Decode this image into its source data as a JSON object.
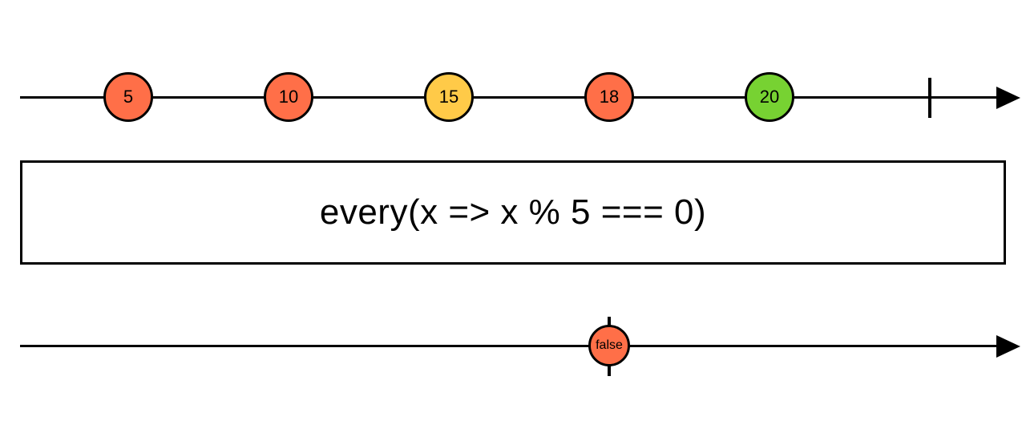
{
  "diagram": {
    "operator_label": "every(x => x % 5 === 0)",
    "input_marbles": [
      {
        "value": "5",
        "color": "#ff6f48"
      },
      {
        "value": "10",
        "color": "#ff6f48"
      },
      {
        "value": "15",
        "color": "#ffca48"
      },
      {
        "value": "18",
        "color": "#ff6f48"
      },
      {
        "value": "20",
        "color": "#77d232"
      }
    ],
    "output_marble": {
      "value": "false",
      "color": "#ff6f48"
    }
  },
  "chart_data": {
    "type": "marble-diagram",
    "operator": "every(x => x % 5 === 0)",
    "input": {
      "events": [
        {
          "time": 1,
          "value": 5
        },
        {
          "time": 2,
          "value": 10
        },
        {
          "time": 3,
          "value": 15
        },
        {
          "time": 4,
          "value": 18
        },
        {
          "time": 5,
          "value": 20
        }
      ],
      "complete_at": 6
    },
    "output": {
      "events": [
        {
          "time": 4,
          "value": false
        }
      ],
      "complete_at": 4
    }
  }
}
